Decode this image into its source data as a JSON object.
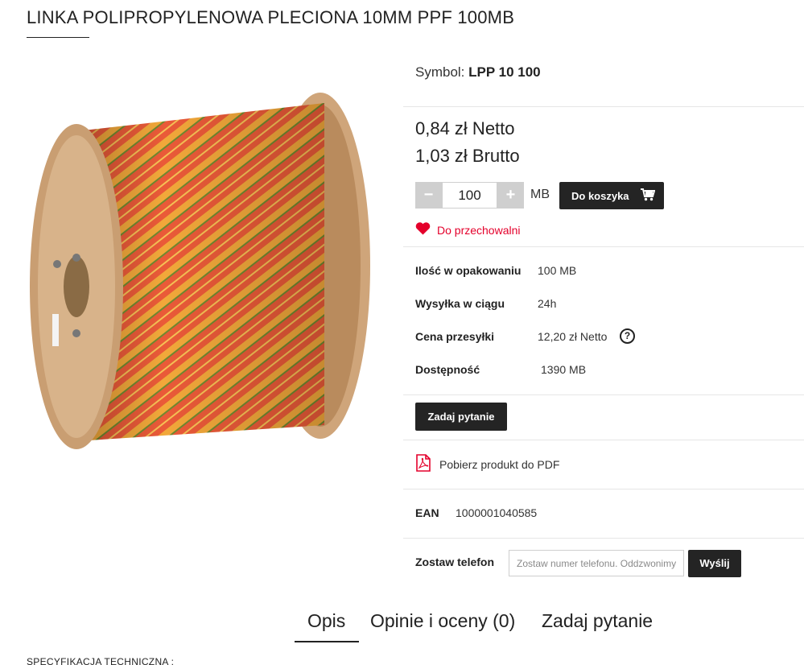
{
  "product": {
    "title": "LINKA POLIPROPYLENOWA PLECIONA 10MM PPF 100MB",
    "symbol_label": "Symbol:",
    "symbol_value": "LPP 10 100",
    "price_net": "0,84 zł Netto",
    "price_gross": "1,03 zł Brutto"
  },
  "quantity": {
    "minus_label": "−",
    "plus_label": "+",
    "value": "100",
    "unit": "MB"
  },
  "actions": {
    "add_to_cart_label": "Do koszyka",
    "wishlist_label": "Do przechowalni",
    "ask_question_label": "Zadaj pytanie",
    "pdf_label": "Pobierz produkt do PDF",
    "send_label": "Wyślij"
  },
  "specs": [
    {
      "label": "Ilość w opakowaniu",
      "value": "100 MB"
    },
    {
      "label": "Wysyłka w ciągu",
      "value": "24h"
    },
    {
      "label": "Cena przesyłki",
      "value": "12,20 zł Netto"
    },
    {
      "label": "Dostępność",
      "value": "1390 MB"
    }
  ],
  "help_icon_label": "?",
  "ean": {
    "label": "EAN",
    "value": "1000001040585"
  },
  "phone": {
    "label": "Zostaw telefon",
    "placeholder": "Zostaw numer telefonu. Oddzwonimy"
  },
  "tabs": [
    {
      "label": "Opis"
    },
    {
      "label": "Opinie i oceny (0)"
    },
    {
      "label": "Zadaj pytanie"
    }
  ],
  "description": {
    "heading": "SPECYFIKACJA TECHNICZNA :"
  },
  "icons": {
    "cart": "cart-icon",
    "heart": "heart-icon",
    "pdf": "pdf-icon",
    "help": "question-circle-icon"
  },
  "colors": {
    "button_dark": "#242424",
    "wishlist_red": "#e4002b",
    "stepper_grey": "#cfcfcf",
    "divider": "#e6e6e6"
  }
}
